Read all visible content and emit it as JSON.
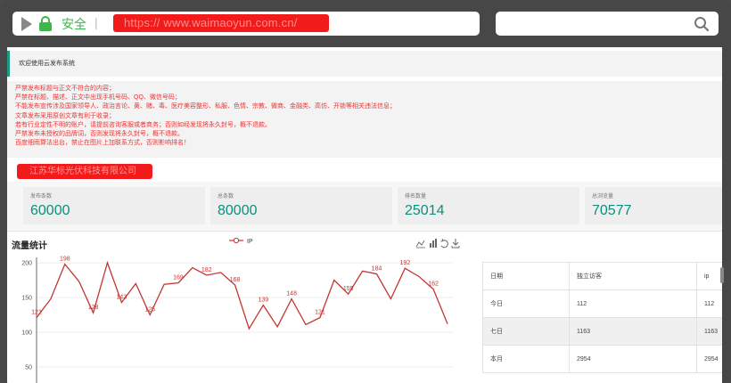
{
  "browser": {
    "security_label": "安全",
    "separator": "|",
    "url": "https://  www.waimaoyun.com.cn/"
  },
  "welcome": "欢迎使用云发布系统",
  "notice_lines": [
    "严禁发布标题与正文不符合的内容；",
    "严禁在标题、描述、正文中出现手机号码、QQ、微信号码；",
    "不能发布宣传涉及国家领导人、政治言论、黄、赌、毒、医疗美容整形、私服、色情、宗教、微商、金融类、高仿、开锁等相关违法信息；",
    "文章发布采用原创文章有利于收录；",
    "若有行业定性不明的账户，请提前咨询客服或者商务；否则如经发现将永久封号，概不退款。",
    "严禁发布未授权的品牌词，否则发现将永久封号，概不退款。",
    "百度细雨算法出台，禁止在图片上加联系方式，否则影响排名！"
  ],
  "company": "江苏华标光伏科技有限公司",
  "stats": [
    {
      "label": "发布条数",
      "value": "60000"
    },
    {
      "label": "总条数",
      "value": "80000"
    },
    {
      "label": "排名数量",
      "value": "25014"
    },
    {
      "label": "总浏览量",
      "value": "70577"
    }
  ],
  "traffic": {
    "title": "流量统计",
    "legend": "IP"
  },
  "chart_data": {
    "type": "line",
    "series": [
      {
        "name": "IP",
        "values": [
          121,
          148,
          198,
          173,
          128,
          200,
          143,
          170,
          125,
          169,
          171,
          193,
          182,
          186,
          168,
          105,
          139,
          108,
          148,
          111,
          121,
          175,
          155,
          188,
          184,
          148,
          192,
          180,
          162,
          112
        ]
      }
    ],
    "labels": [
      {
        "index": 0,
        "text": "121"
      },
      {
        "index": 2,
        "text": "198"
      },
      {
        "index": 4,
        "text": "128"
      },
      {
        "index": 6,
        "text": "143"
      },
      {
        "index": 8,
        "text": "125"
      },
      {
        "index": 10,
        "text": "169"
      },
      {
        "index": 12,
        "text": "182"
      },
      {
        "index": 14,
        "text": "168"
      },
      {
        "index": 16,
        "text": "139"
      },
      {
        "index": 18,
        "text": "148"
      },
      {
        "index": 20,
        "text": "121"
      },
      {
        "index": 22,
        "text": "155"
      },
      {
        "index": 24,
        "text": "184"
      },
      {
        "index": 26,
        "text": "192"
      },
      {
        "index": 28,
        "text": "162"
      }
    ],
    "yticks": [
      200,
      150,
      100,
      50
    ],
    "ylim": [
      40,
      210
    ],
    "color": "#c23531"
  },
  "table": {
    "headers": [
      "日期",
      "独立访客",
      "ip"
    ],
    "rows": [
      [
        "今日",
        "112",
        "112"
      ],
      [
        "七日",
        "1163",
        "1163"
      ],
      [
        "本月",
        "2954",
        "2954"
      ]
    ]
  }
}
